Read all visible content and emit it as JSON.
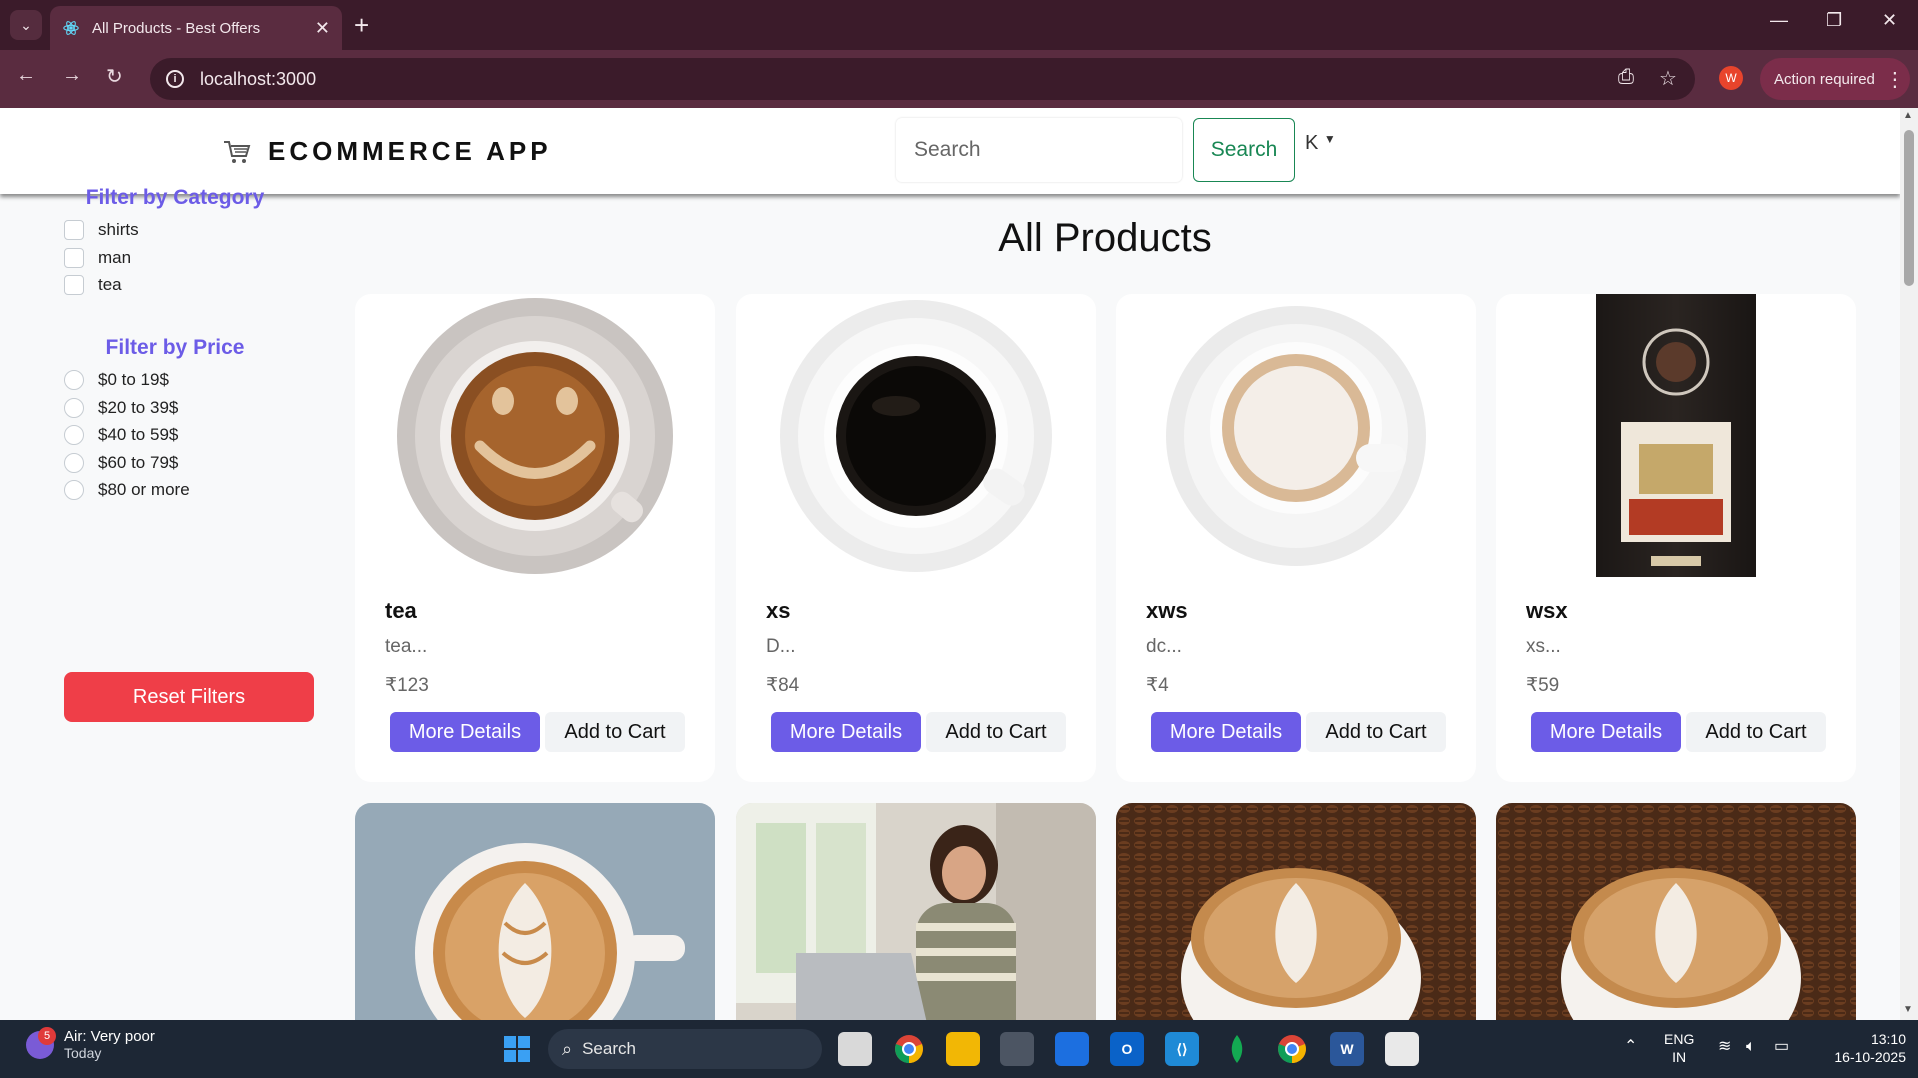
{
  "browser": {
    "tab_title": "All Products - Best Offers",
    "url": "localhost:3000",
    "action_required": "Action required",
    "profile_initial": "W"
  },
  "header": {
    "brand": "ECOMMERCE APP",
    "search_placeholder": "Search",
    "search_button": "Search",
    "user_initial": "K"
  },
  "sidebar": {
    "category_heading": "Filter by Category",
    "categories": [
      "shirts",
      "man",
      "tea"
    ],
    "price_heading": "Filter by Price",
    "prices": [
      "$0 to 19$",
      "$20 to 39$",
      "$40 to 59$",
      "$60 to 79$",
      "$80 or more"
    ],
    "reset_button": "Reset Filters"
  },
  "main": {
    "title": "All Products",
    "more_details_label": "More Details",
    "add_to_cart_label": "Add to Cart",
    "products": [
      {
        "name": "tea",
        "desc": "tea...",
        "price": "₹123",
        "image": "coffee-cup-smiley"
      },
      {
        "name": "xs",
        "desc": "D...",
        "price": "₹84",
        "image": "black-coffee-cup"
      },
      {
        "name": "xws",
        "desc": "dc...",
        "price": "₹4",
        "image": "white-coffee-cup"
      },
      {
        "name": "wsx",
        "desc": "xs...",
        "price": "₹59",
        "image": "coffee-bean-bag"
      },
      {
        "image": "latte-art-cup"
      },
      {
        "image": "woman-at-laptop"
      },
      {
        "image": "latte-on-beans"
      },
      {
        "image": "latte-on-beans"
      }
    ]
  },
  "taskbar": {
    "weather_title": "Air: Very poor",
    "weather_sub": "Today",
    "weather_badge": "5",
    "search_label": "Search",
    "lang_top": "ENG",
    "lang_bottom": "IN",
    "time": "13:10",
    "date": "16-10-2025"
  },
  "colors": {
    "accent": "#6c5ce7",
    "reset": "#ef3e48",
    "search_green": "#198754",
    "chrome": "#5a2c40"
  }
}
